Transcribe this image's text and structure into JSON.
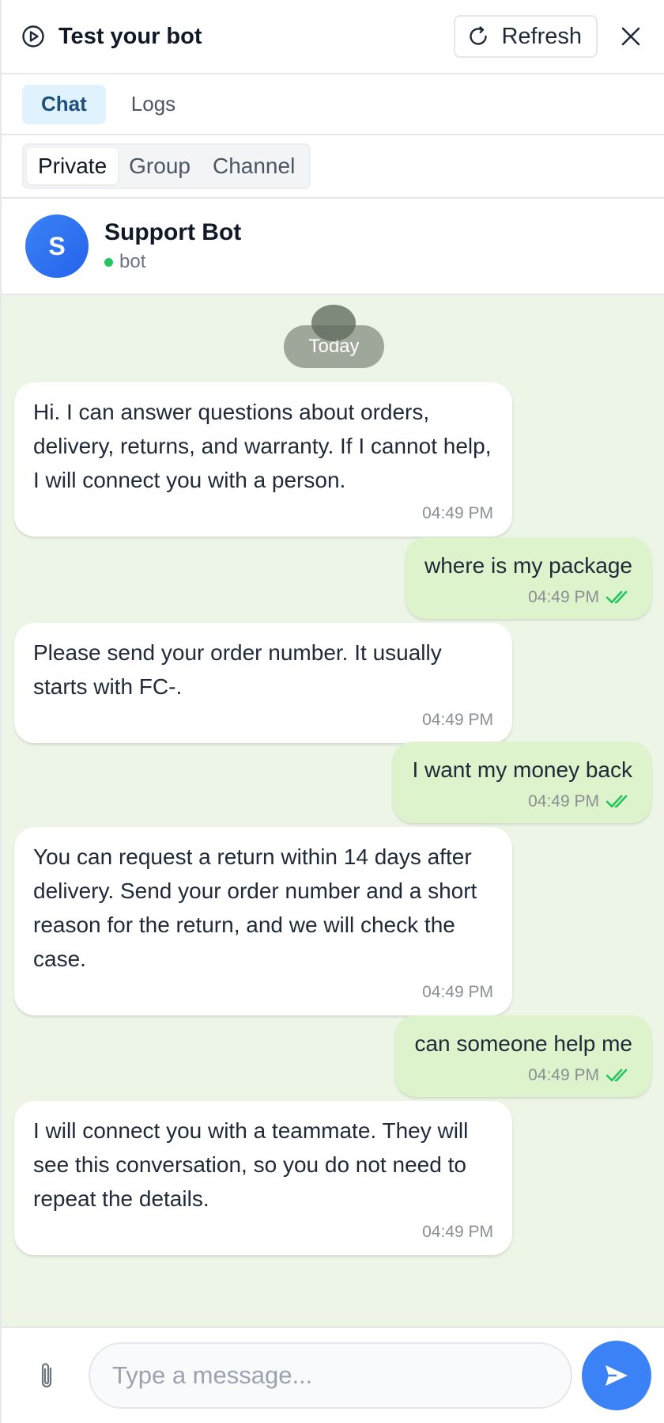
{
  "header": {
    "title": "Test your bot",
    "refresh_label": "Refresh"
  },
  "tabs": [
    {
      "label": "Chat",
      "active": true
    },
    {
      "label": "Logs",
      "active": false
    }
  ],
  "segments": [
    {
      "label": "Private",
      "active": true
    },
    {
      "label": "Group",
      "active": false
    },
    {
      "label": "Channel",
      "active": false
    }
  ],
  "contact": {
    "initial": "S",
    "name": "Support Bot",
    "status": "bot"
  },
  "chat": {
    "date_label": "Today",
    "messages": [
      {
        "direction": "in",
        "text": "Hi. I can answer questions about orders, delivery, returns, and warranty. If I cannot help, I will connect you with a person.",
        "time": "04:49 PM"
      },
      {
        "direction": "out",
        "text": "where is my package",
        "time": "04:49 PM"
      },
      {
        "direction": "in",
        "text": "Please send your order number. It usually starts with FC-.",
        "time": "04:49 PM"
      },
      {
        "direction": "out",
        "text": "I want my money back",
        "time": "04:49 PM"
      },
      {
        "direction": "in",
        "text": "You can request a return within 14 days after delivery. Send your order number and a short reason for the return, and we will check the case.",
        "time": "04:49 PM"
      },
      {
        "direction": "out",
        "text": "can someone help me",
        "time": "04:49 PM"
      },
      {
        "direction": "in",
        "text": "I will connect you with a teammate. They will see this conversation, so you do not need to repeat the details.",
        "time": "04:49 PM"
      }
    ]
  },
  "composer": {
    "placeholder": "Type a message..."
  },
  "colors": {
    "accent": "#3b82f6",
    "outgoing_bubble": "#dcf3cb",
    "chat_background": "#edf5e6",
    "online": "#22c55e",
    "read_check": "#22c55e"
  }
}
